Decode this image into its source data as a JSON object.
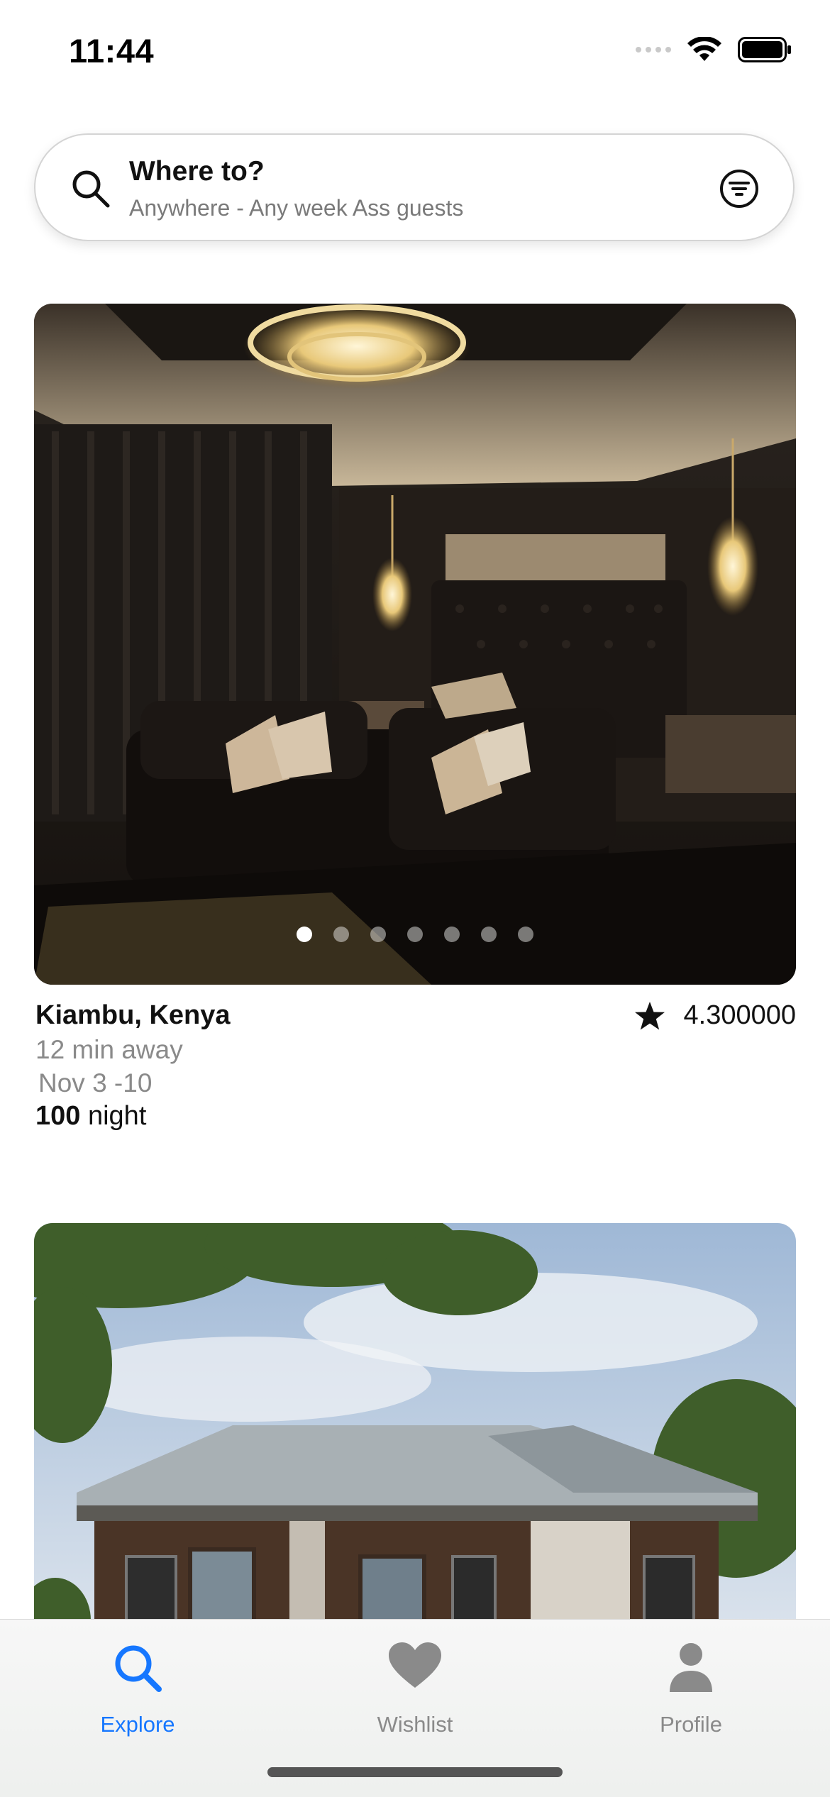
{
  "status_bar": {
    "time": "11:44"
  },
  "search": {
    "title": "Where to?",
    "subtitle": "Anywhere - Any week Ass guests",
    "icon": "search-icon",
    "filter_icon": "filter-icon"
  },
  "listings": [
    {
      "location": "Kiambu, Kenya",
      "rating": "4.300000",
      "distance": "12 min away",
      "dates": "Nov 3 -10",
      "price": "100",
      "price_unit": "night",
      "image_count": 7,
      "active_image": 1
    }
  ],
  "tabs": [
    {
      "label": "Explore",
      "icon": "search-icon",
      "active": true
    },
    {
      "label": "Wishlist",
      "icon": "heart-icon",
      "active": false
    },
    {
      "label": "Profile",
      "icon": "person-icon",
      "active": false
    }
  ],
  "colors": {
    "accent": "#1677ff",
    "inactive": "#8a8a8a"
  }
}
